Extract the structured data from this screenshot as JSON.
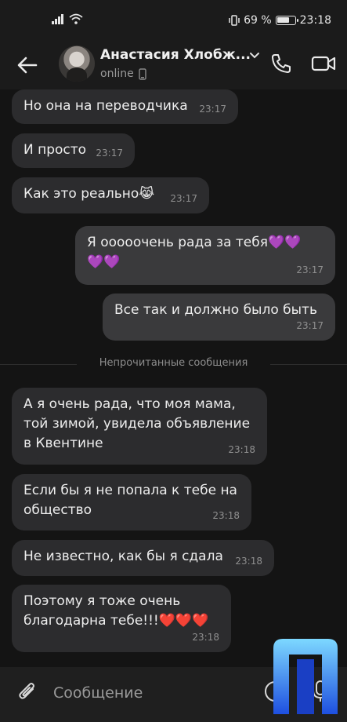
{
  "status_bar": {
    "battery_percent": "69 %",
    "time": "23:18"
  },
  "header": {
    "contact_name": "Анастасия Хлобж...",
    "contact_status": "online"
  },
  "messages": [
    {
      "direction": "in",
      "text": "Но она на переводчика",
      "time": "23:17"
    },
    {
      "direction": "in",
      "text": "И просто",
      "time": "23:17"
    },
    {
      "direction": "in",
      "text": "Как это реально",
      "emoji": "😹",
      "time": "23:17"
    },
    {
      "direction": "out",
      "line1": "Я ооооочень рада за тебя",
      "line2": "",
      "hearts": "💜",
      "time": "23:17"
    },
    {
      "direction": "out",
      "text": "Все так и должно было быть",
      "time": "23:17"
    },
    {
      "direction": "in",
      "text": "А я очень рада, что моя мама, той зимой, увидела объявление в Квентине",
      "line1": "А я очень рада, что моя мама,",
      "line2": "той зимой, увидела объявление",
      "line3": "в Квентине",
      "time": "23:18"
    },
    {
      "direction": "in",
      "line1": "Если бы я не попала к тебе на",
      "line2": "общество",
      "time": "23:18"
    },
    {
      "direction": "in",
      "text": "Не известно, как бы я сдала",
      "time": "23:18"
    },
    {
      "direction": "in",
      "line1": "Поэтому я тоже очень",
      "line2": "благодарна тебе!!!",
      "hearts": "❤️",
      "time": "23:18"
    }
  ],
  "unread_divider": "Непрочитанные сообщения",
  "composer": {
    "placeholder": "Сообщение"
  },
  "colors": {
    "background": "#141414",
    "bubble_in": "#2c2c2e",
    "bubble_out": "#3a3a3c",
    "logo_gradient_top": "#7dd8ff",
    "logo_gradient_bottom": "#1e4fe0"
  },
  "icons": [
    "back-arrow-icon",
    "chevron-down-icon",
    "phone-icon",
    "video-camera-icon",
    "mobile-device-icon",
    "paperclip-icon",
    "sticker-icon",
    "microphone-icon",
    "signal-icon",
    "wifi-icon",
    "vibrate-icon",
    "battery-icon"
  ]
}
